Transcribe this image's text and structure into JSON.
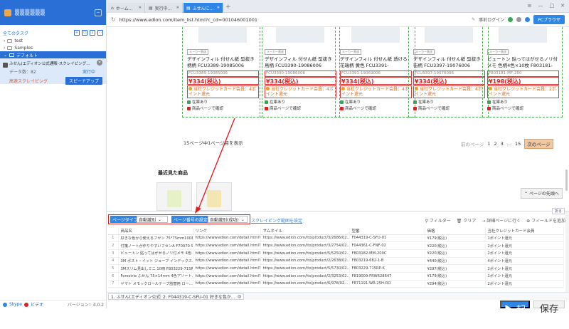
{
  "sidebar": {
    "username": "▒▒▒▒▒▒",
    "tree_title": "全てのタスク",
    "folders": [
      {
        "label": "test"
      },
      {
        "label": "Samples"
      },
      {
        "label": "デフォルト"
      }
    ],
    "task": {
      "title": "ふせん(エディオン公式通販-スクレイピング...",
      "data_label": "データ数：",
      "data_count": "82",
      "status": "実行中",
      "link_label": "高速スクレイピング",
      "speed_button": "スピードアップ"
    },
    "footer": {
      "skype": "Skype",
      "video": "ビデオ",
      "version": "バージョン：4.0.2"
    }
  },
  "tabs": [
    {
      "label": "ホーム..."
    },
    {
      "label": "実行中..."
    },
    {
      "label": "ふせんに..."
    }
  ],
  "address": {
    "url": "https://www.edion.com/item_list.html?c_cd=001046001001",
    "login": "事前ログイン",
    "browser_mode": "PCブラウザ"
  },
  "products": [
    {
      "badge": "メーカー直送",
      "name": "デザインフィル 付せん紙 型抜き 柄柄 FCU3389-19085006",
      "code": "FCU3389-19085006",
      "price": "¥334(税込)",
      "credit": "当社クレジットカード会員：4ポイント還元",
      "stock": "在庫あり",
      "confirm": "商品ページで確認"
    },
    {
      "badge": "メーカー直送",
      "name": "デザインフィル 付せん紙 型抜き 鳥柄 FCU3390-19086006",
      "code": "FCU3390-19086006",
      "price": "¥334(税込)",
      "credit": "当社クレジットカード会員：4ポイント還元",
      "stock": "在庫あり",
      "confirm": "商品ページで確認"
    },
    {
      "badge": "メーカー直送",
      "name": "デザインフィル 付せん紙 透ける 花瑞柄 黄色 FCU3391-19069006",
      "code": "FCU3391-19069006",
      "price": "¥334(税込)",
      "credit": "当社クレジットカード会員：4ポイント還元",
      "stock": "在庫あり",
      "confirm": "商品ページで確認"
    },
    {
      "badge": "メーカー直送",
      "name": "デザインフィル 付せん紙 型抜き 街柄 FCU3397-19076006",
      "code": "FCU3397-19076006",
      "price": "¥334(税込)",
      "credit": "当社クレジットカード会員：4ポイント還元",
      "stock": "在庫あり",
      "confirm": "商品ページで確認"
    },
    {
      "badge": "メーカー直送",
      "name": "ビュートン 貼ってはがせるノリ付メモ 色柄4色×10枚 F803181-MF-200",
      "code": "F803181-MF-200",
      "price": "¥198(税込)",
      "credit": "当社クレジットカード会員：2ポイント還元",
      "stock": "在庫あり",
      "confirm": "商品ページで確認"
    }
  ],
  "page_info": "15ページ中1ページ目を表示",
  "pager": {
    "prev": "前のページ",
    "pages": [
      "1",
      "2",
      "3",
      "...",
      "15"
    ],
    "next": "次のページ"
  },
  "recent_title": "最近見た商品",
  "back_to_top": "ページの先頭へ",
  "panel": {
    "collapse": "折る",
    "page_type_btn": "ページタイプ",
    "page_type_value": "自動識別",
    "page_num_btn": "ページ番号の設定",
    "page_num_value": "自動識別(成功)",
    "scroll_range": "スクレイピング範囲を設定",
    "tools": [
      "フィルター",
      "クリア",
      "詳細ページに行く",
      "フィールドを追加"
    ],
    "columns": [
      "商品名",
      "リンク",
      "サムネイル",
      "型番",
      "価格",
      "当社クレジットカード会員"
    ],
    "rows": [
      [
        "好きな色から使えるフセン 75*75mm100枚...",
        "https://www.edion.com/detail.html?p_cd=0...",
        "https://www.edion.com/ito/product/3/2686/02...",
        "F044319-C-SFU-01",
        "¥179(税込)",
        "1ポイント還元"
      ],
      [
        "付箋ノートが作りやすいフセンA F70070 S...",
        "https://www.edion.com/detail.html?p_cd=0...",
        "https://www.edion.com/ito/product/3/2754/02...",
        "F044361-C-FNF-02",
        "¥220(税込)",
        "2ポイント還元"
      ],
      [
        "ビュートン 貼ってはがせるノリ付メモ 4色...",
        "https://www.edion.com/detail.html?p_cd=0...",
        "https://www.edion.com/ito/product/5/5250/02...",
        "F803182-MM-200C",
        "¥220(税込)",
        "2ポイント還元"
      ],
      [
        "3M ポスト・イット ジョーブ インデックス...",
        "https://www.edion.com/detail.html?p_cd=0...",
        "https://www.edion.com/ito/product/2/2638/02...",
        "F803219-682-1-B",
        "¥440(税込)",
        "4ポイント還元"
      ],
      [
        "3Mスリム見出しミニ 10冊 F803229-715R...",
        "https://www.edion.com/detail.html?p_cd=0...",
        "https://www.edion.com/ito/product/5/5730/02...",
        "F803229-715RP-K",
        "¥297(税込)",
        "2ポイント還元"
      ],
      [
        "Forestrie ふせん 75×14mm 4色アソート...",
        "https://www.edion.com/detail.html?p_cd=0...",
        "https://www.edion.com/ito/product/2/3253/02...",
        "F819009-FRW628647",
        "¥179(税込)",
        "1ポイント還元"
      ],
      [
        "ヤマト メモックロールテープ詰替用 ロー...",
        "https://www.edion.com/detail.html?p_cd=0...",
        "https://www.edion.com/ito/product/6/978/02...",
        "F871191-WR-25H-RO",
        "¥294(税込)",
        "2ポイント還元"
      ]
    ],
    "bottom_tabs": [
      {
        "label": "1. ふせん(エディオン公式通販"
      },
      {
        "label": "2. F044319-C-SFU-01 好きな色か..."
      }
    ],
    "start_button": "▶ 起動",
    "save_button": "保存"
  },
  "colors": {
    "accent": "#2f86e6",
    "price": "#e02020",
    "highlight_box": "#e02020"
  }
}
